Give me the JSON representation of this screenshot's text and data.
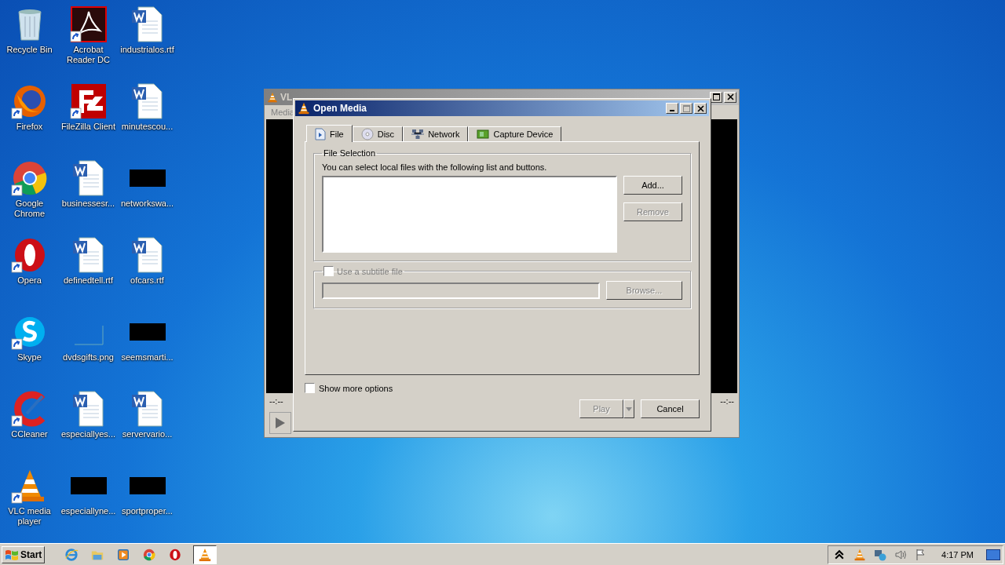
{
  "desktop": {
    "icons": [
      {
        "label": "Recycle Bin",
        "kind": "recycle-bin",
        "shortcut": false
      },
      {
        "label": "Acrobat Reader DC",
        "kind": "pdf",
        "shortcut": true
      },
      {
        "label": "industrialos.rtf",
        "kind": "word",
        "shortcut": false
      },
      {
        "label": "Firefox",
        "kind": "firefox",
        "shortcut": true
      },
      {
        "label": "FileZilla Client",
        "kind": "filezilla",
        "shortcut": true
      },
      {
        "label": "minutescou...",
        "kind": "word",
        "shortcut": false
      },
      {
        "label": "Google Chrome",
        "kind": "chrome",
        "shortcut": true
      },
      {
        "label": "businessesr...",
        "kind": "word",
        "shortcut": false
      },
      {
        "label": "networkswa...",
        "kind": "redacted"
      },
      {
        "label": "Opera",
        "kind": "opera",
        "shortcut": true
      },
      {
        "label": "definedtell.rtf",
        "kind": "word",
        "shortcut": false
      },
      {
        "label": "ofcars.rtf",
        "kind": "word",
        "shortcut": false
      },
      {
        "label": "Skype",
        "kind": "skype",
        "shortcut": true
      },
      {
        "label": "dvdsgifts.png",
        "kind": "image",
        "shortcut": false
      },
      {
        "label": "seemsmarti...",
        "kind": "redacted"
      },
      {
        "label": "CCleaner",
        "kind": "ccleaner",
        "shortcut": true
      },
      {
        "label": "especiallyes...",
        "kind": "word",
        "shortcut": false
      },
      {
        "label": "servervario...",
        "kind": "word",
        "shortcut": false
      },
      {
        "label": "VLC media player",
        "kind": "vlc",
        "shortcut": true
      },
      {
        "label": "especiallyne...",
        "kind": "redacted"
      },
      {
        "label": "sportproper...",
        "kind": "redacted"
      }
    ]
  },
  "player_window": {
    "title": "VL",
    "menu": [
      "Media"
    ],
    "elapsed": "--:--",
    "remaining": "--:--"
  },
  "dialog": {
    "title": "Open Media",
    "tabs": [
      {
        "label": "File",
        "kind": "file",
        "selected": true
      },
      {
        "label": "Disc",
        "kind": "disc",
        "selected": false
      },
      {
        "label": "Network",
        "kind": "network",
        "selected": false
      },
      {
        "label": "Capture Device",
        "kind": "capture",
        "selected": false
      }
    ],
    "file_group": {
      "title": "File Selection",
      "hint": "You can select local files with the following list and buttons.",
      "buttons": [
        {
          "label": "Add...",
          "disabled": false
        },
        {
          "label": "Remove",
          "disabled": true
        }
      ]
    },
    "subtitle": {
      "label": "Use a subtitle file",
      "checked": false,
      "disabled": true,
      "browse": "Browse..."
    },
    "show_more": {
      "label": "Show more options",
      "checked": false
    },
    "play": {
      "label": "Play",
      "disabled": true
    },
    "cancel": "Cancel"
  },
  "taskbar": {
    "start": "Start",
    "apps": [
      {
        "kind": "ie",
        "active": false
      },
      {
        "kind": "folder",
        "active": false
      },
      {
        "kind": "media",
        "active": false
      },
      {
        "kind": "chrome",
        "active": false
      },
      {
        "kind": "opera",
        "active": false
      },
      {
        "kind": "vlc",
        "active": true
      }
    ],
    "tray": [
      {
        "kind": "chevron"
      },
      {
        "kind": "vlc"
      },
      {
        "kind": "network"
      },
      {
        "kind": "volume"
      },
      {
        "kind": "flag"
      }
    ],
    "clock": "4:17 PM"
  }
}
